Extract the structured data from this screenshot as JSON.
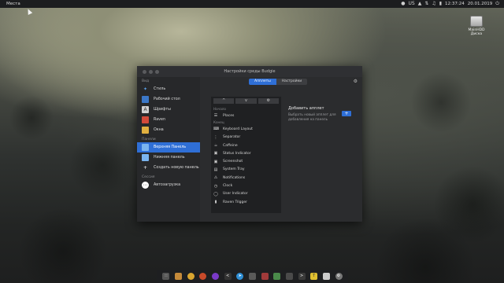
{
  "top_panel": {
    "places_label": "Места",
    "tray_icons": [
      "mic-icon",
      "keyboard-icon",
      "wifi-icon",
      "network-icon",
      "volume-icon",
      "battery-icon",
      "power-icon"
    ],
    "keyboard_layout": "US",
    "clock_time": "12:37:24",
    "clock_date": "20.01.2019"
  },
  "desktop_icon": {
    "label": "MainHDD Диска",
    "icon": "harddisk-icon"
  },
  "window": {
    "title": "Настройки среды Budgie",
    "sidebar": {
      "sections": [
        {
          "heading": "Вид",
          "items": [
            {
              "label": "Стиль",
              "icon": "style-icon",
              "color": "#5aa0e8"
            },
            {
              "label": "Рабочий стол",
              "icon": "desktop-icon",
              "color": "#3c78c8"
            },
            {
              "label": "Шрифты",
              "icon": "fonts-icon",
              "color": "#d0d0d0"
            },
            {
              "label": "Raven",
              "icon": "raven-icon",
              "color": "#d24a3a"
            },
            {
              "label": "Окна",
              "icon": "windows-icon",
              "color": "#e0b040"
            }
          ]
        },
        {
          "heading": "Панели",
          "items": [
            {
              "label": "Верхняя Панель",
              "icon": "folder-icon",
              "color": "#7ab4ef",
              "active": true
            },
            {
              "label": "Нижняя панель",
              "icon": "folder-icon",
              "color": "#7ab4ef"
            },
            {
              "label": "Создать новую панель",
              "icon": "plus-icon",
              "color": "#ffffff"
            }
          ]
        },
        {
          "heading": "Сессия",
          "items": [
            {
              "label": "Автозагрузка",
              "icon": "more-icon",
              "color": "#ffffff"
            }
          ]
        }
      ]
    },
    "tabs": [
      {
        "label": "Апплеты",
        "active": true
      },
      {
        "label": "Настройки",
        "active": false
      }
    ],
    "applet_toolbar": [
      "^",
      "v",
      "⚙"
    ],
    "applet_groups": [
      {
        "heading": "Начало",
        "items": [
          {
            "label": "Places",
            "icon": "list-icon"
          }
        ]
      },
      {
        "heading": "Конец",
        "items": [
          {
            "label": "Keyboard Layout",
            "icon": "keyboard-icon"
          },
          {
            "label": "Separator",
            "icon": "separator-icon"
          },
          {
            "label": "Caffeine",
            "icon": "coffee-icon"
          },
          {
            "label": "Status Indicator",
            "icon": "status-icon"
          },
          {
            "label": "Screenshot",
            "icon": "screenshot-icon"
          },
          {
            "label": "System Tray",
            "icon": "tray-icon"
          },
          {
            "label": "Notifications",
            "icon": "bell-icon"
          },
          {
            "label": "Clock",
            "icon": "clock-icon"
          },
          {
            "label": "User Indicator",
            "icon": "user-icon"
          },
          {
            "label": "Raven Trigger",
            "icon": "raven-icon"
          }
        ]
      }
    ],
    "add_applet": {
      "title": "Добавить апплет",
      "description": "Выбрать новый апплет для добавления на панель",
      "button": "+"
    }
  },
  "dock": {
    "icons": [
      {
        "name": "apps-grid-icon",
        "color": "#555"
      },
      {
        "name": "package-icon",
        "color": "#c58a3a"
      },
      {
        "name": "chrome-icon",
        "color": "#d9a530"
      },
      {
        "name": "firefox-icon",
        "color": "#c84a2a"
      },
      {
        "name": "mpv-icon",
        "color": "#7a3ac8"
      },
      {
        "name": "code-icon",
        "color": "#333"
      },
      {
        "name": "telegram-icon",
        "color": "#2f8fd6"
      },
      {
        "name": "file-manager-icon",
        "color": "#5a5a5a"
      },
      {
        "name": "video-icon",
        "color": "#a03a3a"
      },
      {
        "name": "gallery-icon",
        "color": "#4a8a4a"
      },
      {
        "name": "chat-icon",
        "color": "#4a4a4a"
      },
      {
        "name": "terminal-icon",
        "color": "#3a3a3a"
      },
      {
        "name": "notes-icon",
        "color": "#e0c030"
      },
      {
        "name": "document-icon",
        "color": "#cccccc"
      },
      {
        "name": "settings-icon",
        "color": "#777"
      }
    ]
  }
}
